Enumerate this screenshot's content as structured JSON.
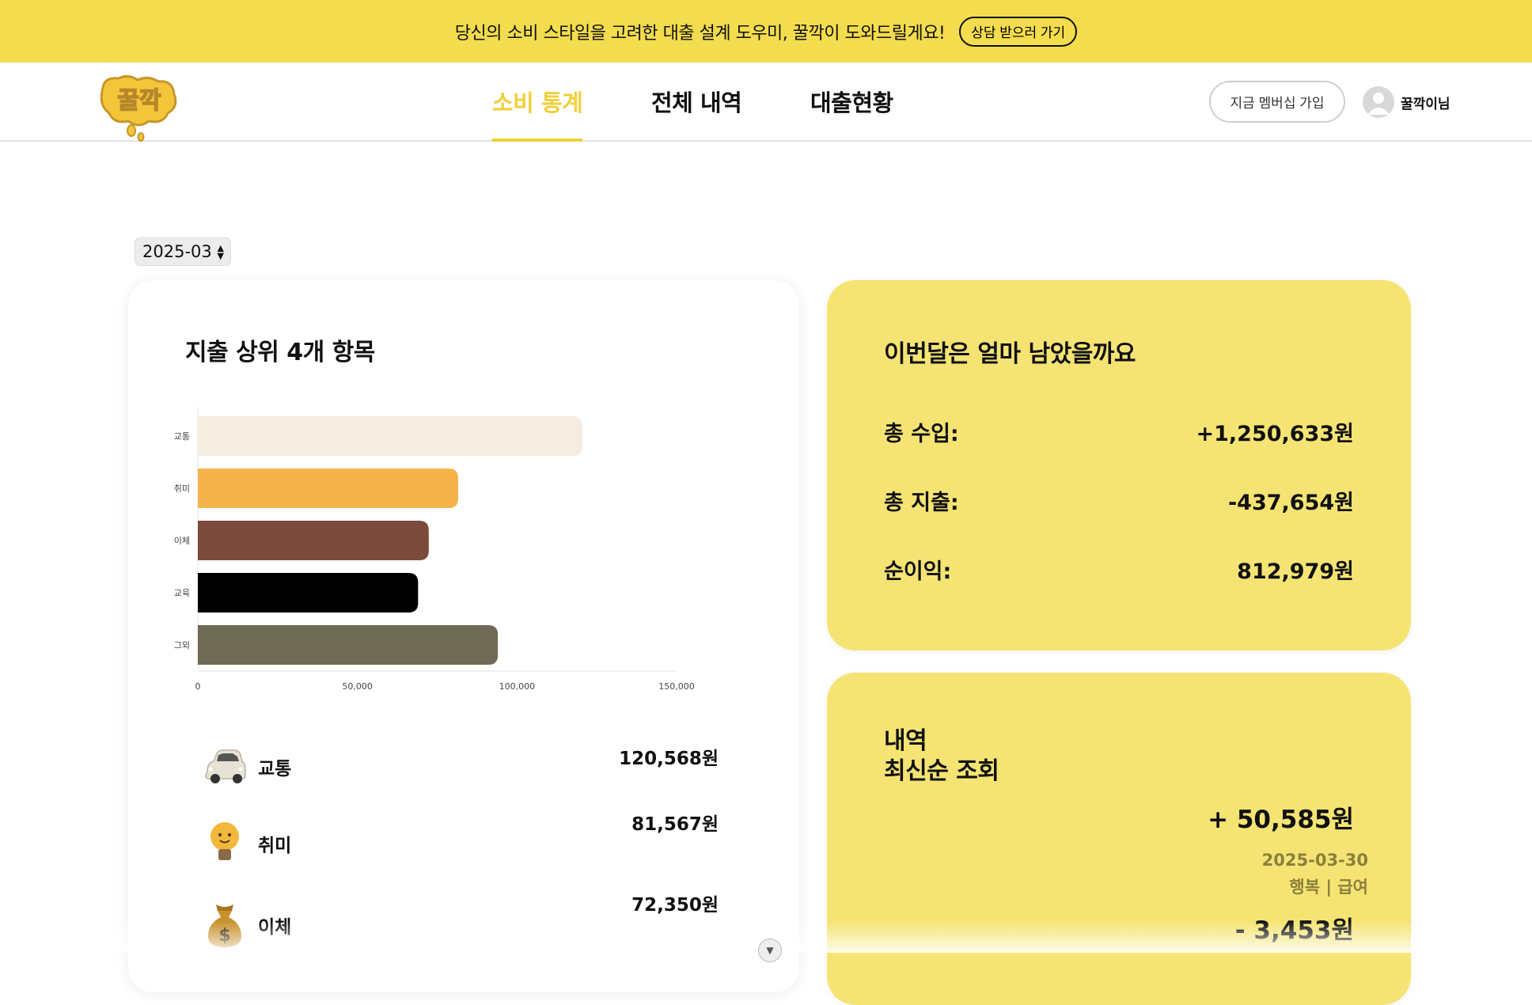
{
  "banner": {
    "text": "당신의 소비 스타일을 고려한 대출 설계 도우미, 꿀깍이 도와드릴게요!",
    "button": "상담 받으러 가기"
  },
  "nav": {
    "logo_icon": "honey-drop-logo",
    "tabs": [
      {
        "label": "소비 통계",
        "active": true
      },
      {
        "label": "전체 내역",
        "active": false
      },
      {
        "label": "대출현황",
        "active": false
      }
    ],
    "member_button": "지금 멤버십 가입",
    "user_name": "꿀깍이님"
  },
  "month_select": {
    "value": "2025-03"
  },
  "top_expenses": {
    "title": "지출 상위 4개 항목",
    "chart_data": {
      "type": "bar",
      "orientation": "horizontal",
      "categories": [
        "교통",
        "취미",
        "이체",
        "교육",
        "그외"
      ],
      "values": [
        120568,
        81567,
        72350,
        69000,
        94000
      ],
      "colors": [
        "#f5ede0",
        "#f5b44a",
        "#7c4a3a",
        "#000000",
        "#6e6a55"
      ],
      "xlim": [
        0,
        150000
      ],
      "xticks": [
        "0",
        "50,000",
        "100,000",
        "150,000"
      ]
    },
    "items": [
      {
        "icon": "car-icon",
        "label": "교통",
        "amount": "120,568원"
      },
      {
        "icon": "lightbulb-icon",
        "label": "취미",
        "amount": "81,567원"
      },
      {
        "icon": "money-bag-icon",
        "label": "이체",
        "amount": "72,350원"
      }
    ]
  },
  "summary": {
    "title": "이번달은 얼마 남았을까요",
    "rows": [
      {
        "label": "총 수입:",
        "value": "+1,250,633원"
      },
      {
        "label": "총 지출:",
        "value": "-437,654원"
      },
      {
        "label": "순이익:",
        "value": "812,979원"
      }
    ]
  },
  "history": {
    "title_line1": "내역",
    "title_line2": "최신순 조회",
    "entries": [
      {
        "amount": "+ 50,585원",
        "date": "2025-03-30",
        "tag": "행복 | 급여"
      },
      {
        "amount": "- 3,453원"
      }
    ]
  },
  "colors": {
    "brand_yellow": "#f3dc4d",
    "card_yellow": "#f5e473",
    "active_tab": "#f2cf3a"
  }
}
